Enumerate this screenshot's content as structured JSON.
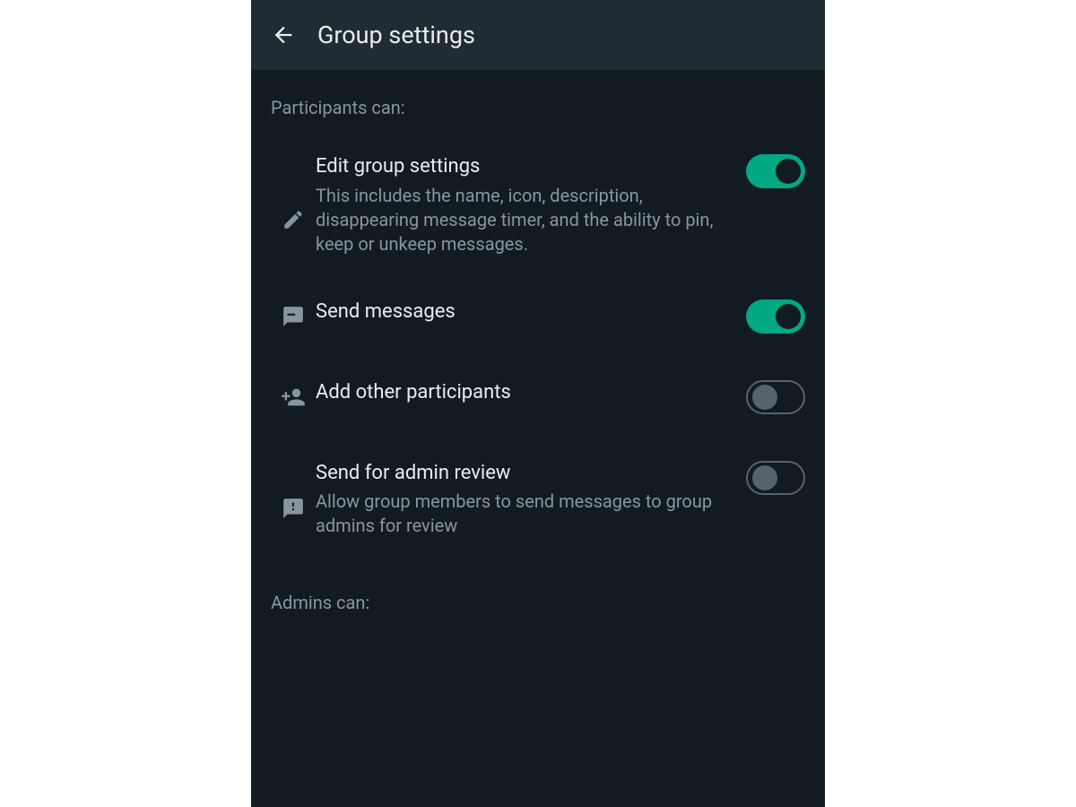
{
  "header": {
    "title": "Group settings"
  },
  "sections": {
    "participants_label": "Participants can:",
    "admins_label": "Admins can:"
  },
  "settings": {
    "edit_group": {
      "title": "Edit group settings",
      "description": "This includes the name, icon, description, disappearing message timer, and the ability to pin, keep or unkeep messages.",
      "enabled": true
    },
    "send_messages": {
      "title": "Send messages",
      "enabled": true
    },
    "add_participants": {
      "title": "Add other participants",
      "enabled": false
    },
    "admin_review": {
      "title": "Send for admin review",
      "description": "Allow group members to send messages to group admins for review",
      "enabled": false
    }
  }
}
